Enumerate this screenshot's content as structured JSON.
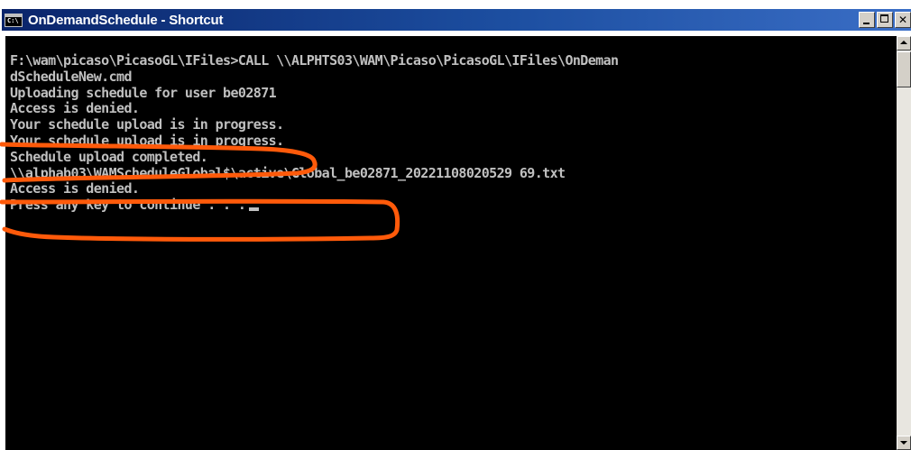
{
  "window": {
    "title": "OnDemandSchedule - Shortcut",
    "icon_label": "C:\\"
  },
  "console": {
    "lines": [
      "F:\\wam\\picaso\\PicasoGL\\IFiles>CALL \\\\ALPHTS03\\WAM\\Picaso\\PicasoGL\\IFiles\\OnDeman",
      "dScheduleNew.cmd",
      "Uploading schedule for user be02871",
      "Access is denied.",
      "Your schedule upload is in progress.",
      "Your schedule upload is in progress.",
      "Schedule upload completed.",
      "\\\\alphab03\\WAMScheduleGlobal$\\active\\Global_be02871_20221108020529 69.txt",
      "Access is denied.",
      "Press any key to continue . . ."
    ]
  },
  "colors": {
    "console_bg": "#000000",
    "console_fg": "#c0c0c0",
    "titlebar": "#0a246a",
    "annotation": "#ff5a0a"
  },
  "icons": {
    "app": "console-icon",
    "minimize": "minimize-icon",
    "maximize": "maximize-icon",
    "close": "close-icon",
    "scroll_up": "arrow-up-icon",
    "scroll_down": "arrow-down-icon"
  }
}
